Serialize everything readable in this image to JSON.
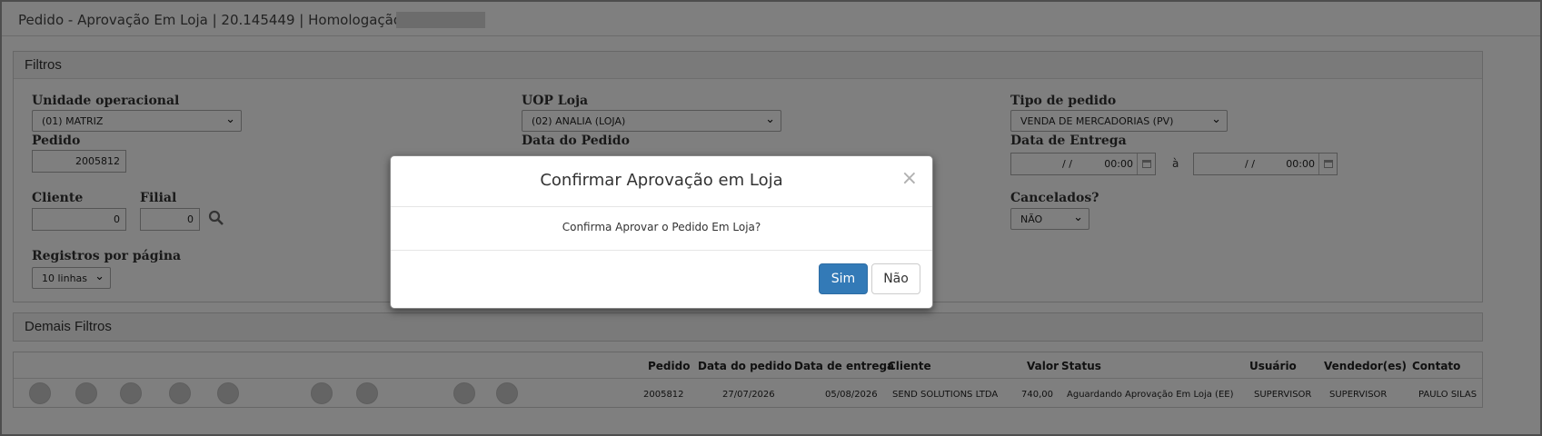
{
  "window": {
    "title": "Pedido - Aprovação Em Loja | 20.145449 | Homologação |"
  },
  "filters": {
    "heading": "Filtros",
    "unidade_label": "Unidade operacional",
    "unidade_value": "(01) MATRIZ",
    "uop_label": "UOP Loja",
    "uop_value": "(02) ANALIA (LOJA)",
    "tipo_label": "Tipo de pedido",
    "tipo_value": "VENDA DE MERCADORIAS (PV)",
    "pedido_label": "Pedido",
    "pedido_value": "2005812",
    "data_pedido_label": "Data do Pedido",
    "data_entrega_label": "Data de Entrega",
    "data_entrega_from_date": "/ /",
    "data_entrega_from_time": "00:00",
    "data_entrega_sep": "à",
    "data_entrega_to_date": "/ /",
    "data_entrega_to_time": "00:00",
    "cliente_label": "Cliente",
    "cliente_value": "0",
    "filial_label": "Filial",
    "filial_value": "0",
    "cancelados_label": "Cancelados?",
    "cancelados_value": "NÃO",
    "registros_label": "Registros por página",
    "registros_value": "10 linhas"
  },
  "more_filters": {
    "heading": "Demais Filtros"
  },
  "table": {
    "headers": [
      "Pedido",
      "Data do pedido",
      "Data de entrega",
      "Cliente",
      "Valor",
      "Status",
      "Usuário",
      "Vendedor(es)",
      "Contato"
    ],
    "row": [
      "2005812",
      "27/07/2026",
      "05/08/2026",
      "SEND SOLUTIONS LTDA",
      "740,00",
      "Aguardando Aprovação Em Loja (EE)",
      "SUPERVISOR",
      "SUPERVISOR",
      "PAULO SILAS"
    ],
    "action_icons": [
      "edit-icon",
      "block-icon",
      "history-icon",
      "list-icon",
      "list-icon",
      "undo-icon",
      "check-icon",
      "cancel-icon",
      "dollar-icon"
    ]
  },
  "modal": {
    "title": "Confirmar Aprovação em Loja",
    "close_glyph": "×",
    "message": "Confirma Aprovar o Pedido Em Loja?",
    "confirm_label": "Sim",
    "cancel_label": "Não"
  },
  "colors": {
    "primary_button": "#337ab7",
    "overlay": "rgba(0,0,0,0.5)"
  }
}
